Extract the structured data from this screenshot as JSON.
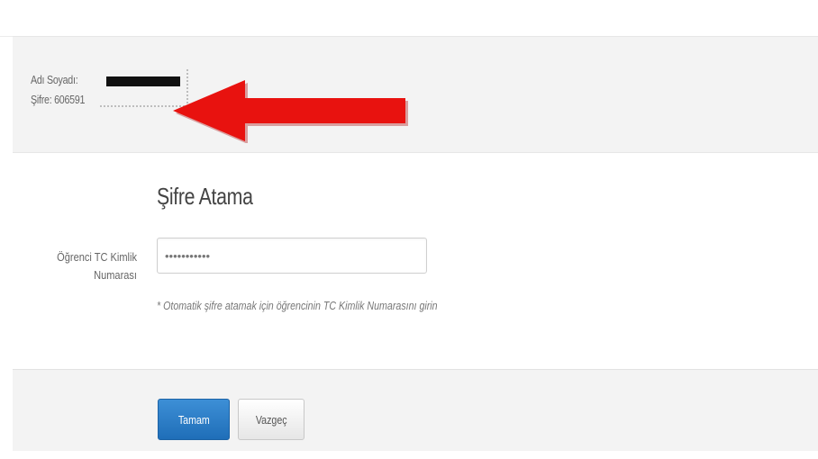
{
  "info": {
    "name_label": "Adı Soyadı:",
    "password_line": "Şifre: 606591"
  },
  "form": {
    "title": "Şifre Atama",
    "field_label": "Öğrenci TC Kimlik Numarası",
    "field_value": "•••••••••••",
    "hint": "* Otomatik şifre atamak için öğrencinin TC Kimlik Numarasını girin"
  },
  "buttons": {
    "save_label": "Tamam",
    "cancel_label": "Vazgeç"
  },
  "colors": {
    "arrow": "#e8120f",
    "primary_button": "#1f6eb8"
  }
}
